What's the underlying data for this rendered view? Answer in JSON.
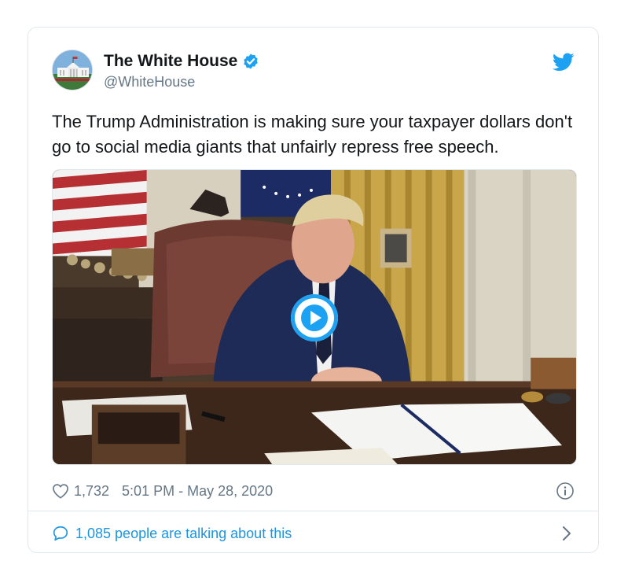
{
  "account": {
    "name": "The White House",
    "handle": "@WhiteHouse",
    "verified": true
  },
  "tweet": {
    "text": "The Trump Administration is making sure your taxpayer dollars don't go to social media giants that unfairly repress free speech."
  },
  "media": {
    "type": "video",
    "icon": "play-icon"
  },
  "footer": {
    "likes": "1,732",
    "timestamp": "5:01 PM - May 28, 2020",
    "conversation": "1,085 people are talking about this"
  },
  "colors": {
    "accent": "#1da1f2",
    "link": "#1b95e0",
    "secondary_text": "#657786",
    "border": "#e1e8ed"
  }
}
